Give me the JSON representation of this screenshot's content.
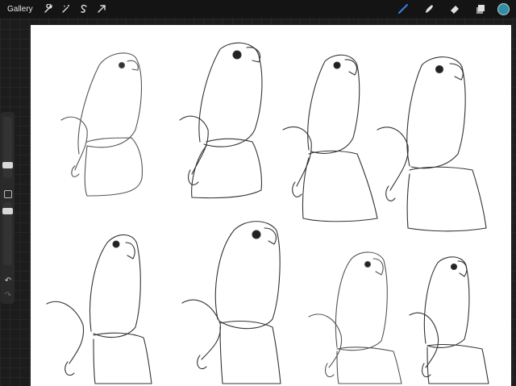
{
  "topbar": {
    "gallery_label": "Gallery",
    "left_tools": [
      {
        "name": "wrench-icon"
      },
      {
        "name": "magic-wand-icon"
      },
      {
        "name": "selection-icon"
      },
      {
        "name": "transform-arrow-icon"
      }
    ],
    "right_tools": [
      {
        "name": "brush-icon",
        "active": true
      },
      {
        "name": "smudge-icon"
      },
      {
        "name": "eraser-icon"
      },
      {
        "name": "layers-icon"
      }
    ],
    "current_color": "#2f8ea6",
    "accent_color": "#3b7fe0"
  },
  "sidebar": {
    "brush_size_level": 0.72,
    "opacity_level": 0.45
  },
  "canvas": {
    "background": "#ffffff",
    "sketch_count": 8
  }
}
